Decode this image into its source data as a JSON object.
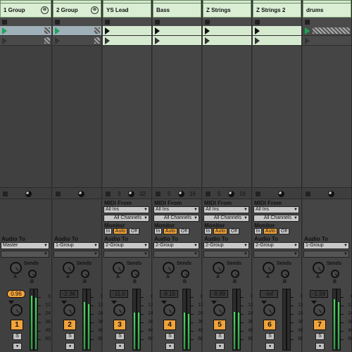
{
  "tracks": [
    {
      "name": "1 Group",
      "type": "group",
      "volume": "0.96",
      "number": "1",
      "audio_to": "Master",
      "meter": 0.88,
      "meter_b": 0.85
    },
    {
      "name": "2 Group",
      "type": "group",
      "volume": "-2.36",
      "number": "2",
      "audio_to": "1-Group",
      "meter": 0.78,
      "meter_b": 0.75
    },
    {
      "name": "YS Lead",
      "type": "midi",
      "volume": "-11.0",
      "number": "3",
      "audio_to": "2-Group",
      "midi_from": "All Ins",
      "channel": "All Channels",
      "stop_a": "3",
      "stop_b": "32",
      "meter": 0.6,
      "meter_b": 0.6
    },
    {
      "name": "Bass",
      "type": "midi",
      "volume": "-8.15",
      "number": "4",
      "audio_to": "2-Group",
      "midi_from": "All Ins",
      "channel": "All Channels",
      "stop_a": "5",
      "stop_b": "16",
      "meter": 0.6,
      "meter_b": 0.58
    },
    {
      "name": "Z Strings",
      "type": "midi",
      "volume": "-8.99",
      "number": "5",
      "audio_to": "2-Group",
      "midi_from": "All Ins",
      "channel": "All Channels",
      "stop_a": "5",
      "stop_b": "16",
      "meter": 0.62,
      "meter_b": 0.6
    },
    {
      "name": "Z Strings 2",
      "type": "midi",
      "volume": "-Inf",
      "number": "6",
      "audio_to": "2-Group",
      "midi_from": "All Ins",
      "channel": "All Channels",
      "meter": 0,
      "meter_b": 0
    },
    {
      "name": "drums",
      "type": "audio",
      "volume": "-1.59",
      "number": "7",
      "audio_to": "1-Group",
      "meter": 0.82,
      "meter_b": 0.78
    }
  ],
  "labels": {
    "midi_from": "MIDI From",
    "monitor": "Monitor",
    "audio_to": "Audio To",
    "sends": "Sends",
    "mon_in": "In",
    "mon_auto": "Auto",
    "mon_off": "Off",
    "send_a": "A",
    "send_b": "B",
    "solo": "S"
  },
  "scale": [
    "0",
    "12",
    "24",
    "36",
    "48",
    "60"
  ],
  "colors": {
    "accent": "#f2a33a",
    "clip_header": "#d9eed3",
    "meter": "#3fe05a"
  }
}
